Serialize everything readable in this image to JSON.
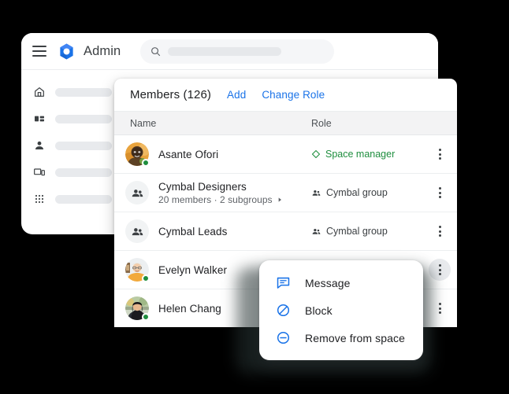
{
  "app": {
    "title": "Admin",
    "logo_icon": "google-admin-hexagon-logo",
    "menu_icon": "hamburger-menu-icon",
    "accent_blue": "#1a73e8",
    "accent_green": "#1e8e3e",
    "background": "#000000"
  },
  "search": {
    "icon": "search-icon",
    "value": "",
    "placeholder": ""
  },
  "sidebar": {
    "items": [
      {
        "icon": "home-icon",
        "label": ""
      },
      {
        "icon": "dashboard-icon",
        "label": ""
      },
      {
        "icon": "person-icon",
        "label": ""
      },
      {
        "icon": "devices-icon",
        "label": ""
      },
      {
        "icon": "apps-grid-icon",
        "label": ""
      }
    ]
  },
  "members_panel": {
    "title": "Members (126)",
    "add_label": "Add",
    "change_role_label": "Change Role",
    "columns": {
      "name": "Name",
      "role": "Role"
    },
    "rows": [
      {
        "name": "Asante Ofori",
        "subtitle": "",
        "avatar": "photo-avatar-asante",
        "presence": "online",
        "role": "Space manager",
        "role_icon": "diamond-icon",
        "role_style": "green",
        "kebab_icon": "more-vert-icon",
        "kebab_active": false
      },
      {
        "name": "Cymbal Designers",
        "subtitle": "20 members  ·  2 subgroups",
        "subtitle_arrow": "chevron-right-icon",
        "avatar": "group-icon",
        "presence": "none",
        "role": "Cymbal group",
        "role_icon": "group-icon",
        "role_style": "grey",
        "kebab_icon": "more-vert-icon",
        "kebab_active": false
      },
      {
        "name": "Cymbal Leads",
        "subtitle": "",
        "avatar": "group-icon",
        "presence": "none",
        "role": "Cymbal group",
        "role_icon": "group-icon",
        "role_style": "grey",
        "kebab_icon": "more-vert-icon",
        "kebab_active": false
      },
      {
        "name": "Evelyn Walker",
        "subtitle": "",
        "avatar": "photo-avatar-evelyn",
        "presence": "online",
        "role": "",
        "role_icon": "",
        "role_style": "grey",
        "kebab_icon": "more-vert-icon",
        "kebab_active": true
      },
      {
        "name": "Helen Chang",
        "subtitle": "",
        "avatar": "photo-avatar-helen",
        "presence": "online",
        "role": "",
        "role_icon": "",
        "role_style": "grey",
        "kebab_icon": "more-vert-icon",
        "kebab_active": false
      }
    ]
  },
  "context_menu": {
    "items": [
      {
        "label": "Message",
        "icon": "message-chat-icon"
      },
      {
        "label": "Block",
        "icon": "block-icon"
      },
      {
        "label": "Remove from space",
        "icon": "remove-circle-icon"
      }
    ]
  }
}
